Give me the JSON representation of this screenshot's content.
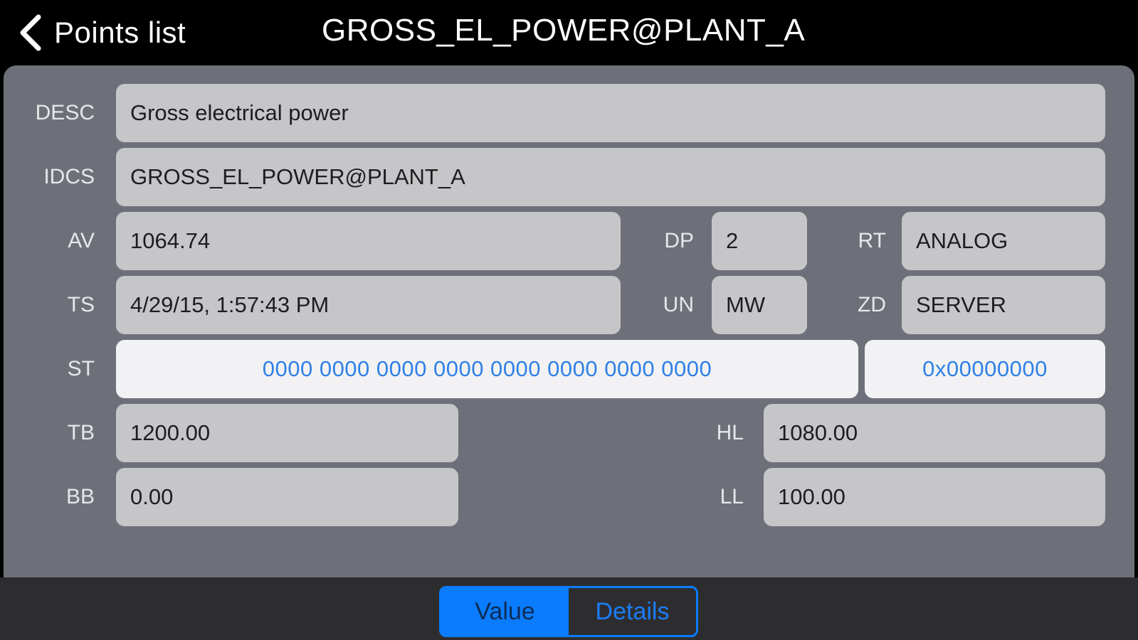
{
  "header": {
    "back_label": "Points list",
    "title": "GROSS_EL_POWER@PLANT_A"
  },
  "fields": {
    "desc": {
      "label": "DESC",
      "value": "Gross electrical power"
    },
    "idcs": {
      "label": "IDCS",
      "value": "GROSS_EL_POWER@PLANT_A"
    },
    "av": {
      "label": "AV",
      "value": "1064.74"
    },
    "dp": {
      "label": "DP",
      "value": "2"
    },
    "rt": {
      "label": "RT",
      "value": "ANALOG"
    },
    "ts": {
      "label": "TS",
      "value": "4/29/15, 1:57:43 PM"
    },
    "un": {
      "label": "UN",
      "value": "MW"
    },
    "zd": {
      "label": "ZD",
      "value": "SERVER"
    },
    "st": {
      "label": "ST",
      "bits": "0000 0000 0000 0000 0000 0000 0000 0000",
      "hex": "0x00000000"
    },
    "tb": {
      "label": "TB",
      "value": "1200.00"
    },
    "hl": {
      "label": "HL",
      "value": "1080.00"
    },
    "bb": {
      "label": "BB",
      "value": "0.00"
    },
    "ll": {
      "label": "LL",
      "value": "100.00"
    }
  },
  "segmented": {
    "selected": "Value",
    "value_label": "Value",
    "details_label": "Details"
  },
  "colors": {
    "accent": "#0a7cff",
    "panel": "#6e7079",
    "field": "#c6c6c9",
    "link_text": "#2f80e6"
  }
}
